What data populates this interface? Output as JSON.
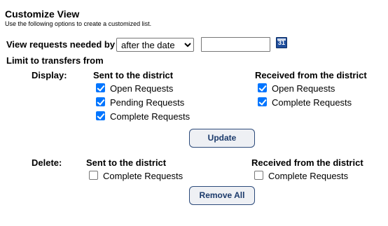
{
  "header": {
    "title": "Customize View",
    "subtitle": "Use the following options to create a customized list."
  },
  "requests_needed": {
    "label": "View requests needed by",
    "select_value": "after the date",
    "select_options": [
      "after the date"
    ],
    "date_value": "",
    "calendar_label": "31"
  },
  "limit_label": "Limit to transfers from",
  "display": {
    "label": "Display:",
    "sent": {
      "heading": "Sent to the district",
      "options": [
        {
          "label": "Open Requests",
          "checked": true
        },
        {
          "label": "Pending Requests",
          "checked": true
        },
        {
          "label": "Complete Requests",
          "checked": true
        }
      ]
    },
    "received": {
      "heading": "Received from the district",
      "options": [
        {
          "label": "Open Requests",
          "checked": true
        },
        {
          "label": "Complete Requests",
          "checked": true
        }
      ]
    },
    "update_label": "Update"
  },
  "delete": {
    "label": "Delete:",
    "sent": {
      "heading": "Sent to the district",
      "options": [
        {
          "label": "Complete Requests",
          "checked": false
        }
      ]
    },
    "received": {
      "heading": "Received from the district",
      "options": [
        {
          "label": "Complete Requests",
          "checked": false
        }
      ]
    },
    "remove_label": "Remove All"
  },
  "colors": {
    "checkbox_checked": "#0075ff",
    "button_border": "#2c4a7a",
    "calendar_icon": "#1f4e9c"
  }
}
